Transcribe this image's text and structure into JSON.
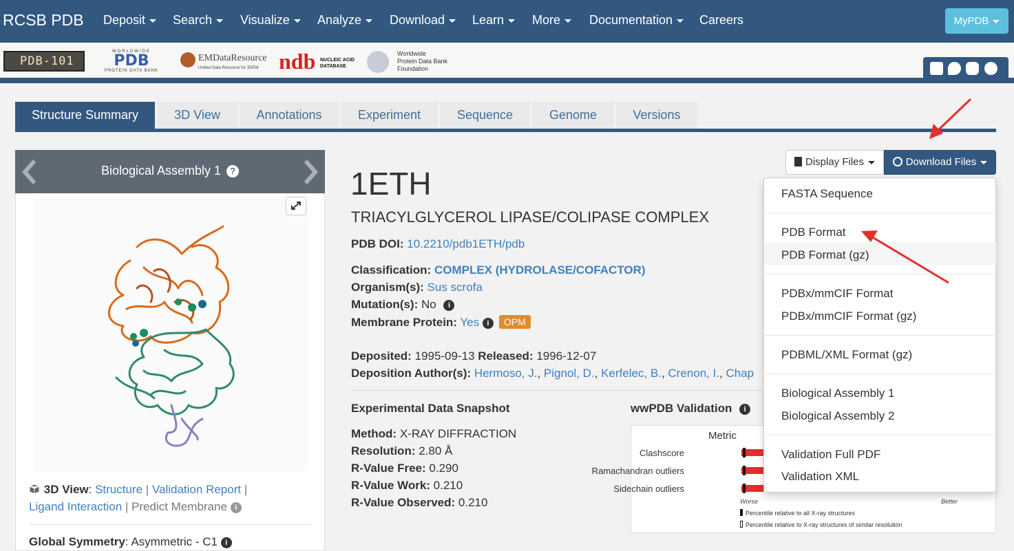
{
  "navbar": {
    "brand": "RCSB PDB",
    "items": [
      "Deposit",
      "Search",
      "Visualize",
      "Analyze",
      "Download",
      "Learn",
      "More",
      "Documentation",
      "Careers"
    ],
    "mypdb": "MyPDB"
  },
  "partners": {
    "pdb101": "PDB-101",
    "wwpdb_top": "WORLDWIDE",
    "wwpdb_mid": "PDB",
    "wwpdb_bot": "PROTEIN DATA BANK",
    "emdb_main": "EMDataResource",
    "emdb_sub": "Unified Data Resource for 3DEM",
    "ndb_big": "ndb",
    "ndb_small_1": "NUCLEIC ACID",
    "ndb_small_2": "DATABASE",
    "wwpdbf_1": "Worldwide",
    "wwpdbf_2": "Protein Data Bank",
    "wwpdbf_3": "Foundation"
  },
  "tabs": [
    "Structure Summary",
    "3D View",
    "Annotations",
    "Experiment",
    "Sequence",
    "Genome",
    "Versions"
  ],
  "left_panel": {
    "assembly_title": "Biological Assembly 1",
    "help": "?",
    "view_label": "3D View",
    "view_links": [
      "Structure",
      "Validation Report"
    ],
    "ligand_link": "Ligand Interaction",
    "predict_membrane": "Predict Membrane",
    "symmetry_label": "Global Symmetry",
    "symmetry_value": ": Asymmetric - C1"
  },
  "entry": {
    "id": "1ETH",
    "name": "TRIACYLGLYCEROL LIPASE/COLIPASE COMPLEX",
    "doi_label": "PDB DOI:",
    "doi": "10.2210/pdb1ETH/pdb",
    "classification_label": "Classification:",
    "classification": "COMPLEX (HYDROLASE/COFACTOR)",
    "organism_label": "Organism(s):",
    "organism": "Sus scrofa",
    "mutation_label": "Mutation(s):",
    "mutation": "No",
    "membrane_label": "Membrane Protein:",
    "membrane": "Yes",
    "opm": "OPM",
    "deposited_label": "Deposited:",
    "deposited": "1995-09-13",
    "released_label": "Released:",
    "released": "1996-12-07",
    "authors_label": "Deposition Author(s):",
    "authors": [
      "Hermoso, J.",
      "Pignol, D.",
      "Kerfelec, B.",
      "Crenon, I.",
      "Chap"
    ]
  },
  "snapshot": {
    "title": "Experimental Data Snapshot",
    "method_label": "Method:",
    "method": "X-RAY DIFFRACTION",
    "resolution_label": "Resolution:",
    "resolution": "2.80 Å",
    "rfree_label": "R-Value Free:",
    "rfree": "0.290",
    "rwork_label": "R-Value Work:",
    "rwork": "0.210",
    "robs_label": "R-Value Observed:",
    "robs": "0.210"
  },
  "validation": {
    "title": "wwPDB Validation",
    "metric": "Metric",
    "rows": [
      "Clashscore",
      "Ramachandran outliers",
      "Sidechain outliers"
    ],
    "worse": "Worse",
    "better": "Better",
    "legend_1": "Percentile relative to all X-ray structures",
    "legend_2": "Percentile relative to X-ray structures of similar resolution"
  },
  "files": {
    "display": "Display Files",
    "download": "Download Files",
    "menu": [
      "FASTA Sequence",
      "PDB Format",
      "PDB Format (gz)",
      "PDBx/mmCIF Format",
      "PDBx/mmCIF Format (gz)",
      "PDBML/XML Format (gz)",
      "Biological Assembly 1",
      "Biological Assembly 2",
      "Validation Full PDF",
      "Validation XML"
    ]
  },
  "colors": {
    "brand": "#325880",
    "link": "#3f7fbf",
    "mypdb": "#5bc0de",
    "opm": "#e38a2b",
    "annotation": "#e62d2d",
    "chain_a": "#d9691c",
    "chain_b": "#2e8b6a",
    "chain_c": "#8a7fc0"
  }
}
